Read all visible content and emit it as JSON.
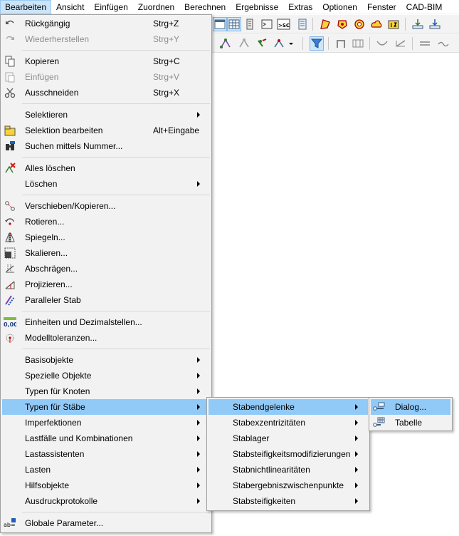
{
  "menubar": {
    "items": [
      "Bearbeiten",
      "Ansicht",
      "Einfügen",
      "Zuordnen",
      "Berechnen",
      "Ergebnisse",
      "Extras",
      "Optionen",
      "Fenster",
      "CAD-BIM"
    ],
    "active_index": 0
  },
  "main_menu": {
    "items": [
      {
        "label": "Rückgängig",
        "shortcut": "Strg+Z",
        "icon": "undo-icon"
      },
      {
        "label": "Wiederherstellen",
        "shortcut": "Strg+Y",
        "icon": "redo-icon",
        "disabled": true
      },
      {
        "label": "Kopieren",
        "shortcut": "Strg+C",
        "icon": "copy-icon"
      },
      {
        "label": "Einfügen",
        "shortcut": "Strg+V",
        "icon": "paste-icon",
        "disabled": true
      },
      {
        "label": "Ausschneiden",
        "shortcut": "Strg+X",
        "icon": "cut-icon"
      },
      {
        "label": "Selektieren",
        "submenu": true
      },
      {
        "label": "Selektion bearbeiten",
        "shortcut": "Alt+Eingabe",
        "icon": "edit-selection-icon"
      },
      {
        "label": "Suchen mittels Nummer...",
        "icon": "binoculars-icon"
      },
      {
        "label": "Alles löschen",
        "icon": "delete-all-icon"
      },
      {
        "label": "Löschen",
        "submenu": true
      },
      {
        "label": "Verschieben/Kopieren...",
        "icon": "move-copy-icon"
      },
      {
        "label": "Rotieren...",
        "icon": "rotate-icon"
      },
      {
        "label": "Spiegeln...",
        "icon": "mirror-icon"
      },
      {
        "label": "Skalieren...",
        "icon": "scale-icon"
      },
      {
        "label": "Abschrägen...",
        "icon": "shear-icon"
      },
      {
        "label": "Projizieren...",
        "icon": "project-icon"
      },
      {
        "label": "Paralleler Stab",
        "icon": "parallel-member-icon"
      },
      {
        "label": "Einheiten und Dezimalstellen...",
        "icon": "units-icon"
      },
      {
        "label": "Modelltoleranzen...",
        "icon": "tolerance-icon"
      },
      {
        "label": "Basisobjekte",
        "submenu": true
      },
      {
        "label": "Spezielle Objekte",
        "submenu": true
      },
      {
        "label": "Typen für Knoten",
        "submenu": true
      },
      {
        "label": "Typen für Stäbe",
        "submenu": true,
        "highlighted": true
      },
      {
        "label": "Imperfektionen",
        "submenu": true
      },
      {
        "label": "Lastfälle und Kombinationen",
        "submenu": true
      },
      {
        "label": "Lastassistenten",
        "submenu": true
      },
      {
        "label": "Lasten",
        "submenu": true
      },
      {
        "label": "Hilfsobjekte",
        "submenu": true
      },
      {
        "label": "Ausdruckprotokolle",
        "submenu": true
      },
      {
        "label": "Globale Parameter...",
        "icon": "global-parameters-icon"
      }
    ],
    "units_icon_text": "0,00",
    "global_icon_text": "ab="
  },
  "submenu_staebe": {
    "items": [
      {
        "label": "Stabendgelenke",
        "highlighted": true
      },
      {
        "label": "Stabexzentrizitäten"
      },
      {
        "label": "Stablager"
      },
      {
        "label": "Stabsteifigkeitsmodifizierungen"
      },
      {
        "label": "Stabnichtlinearitäten"
      },
      {
        "label": "Stabergebniszwischenpunkte"
      },
      {
        "label": "Stabsteifigkeiten"
      }
    ]
  },
  "submenu_gelenke": {
    "items": [
      {
        "label": "Dialog...",
        "highlighted": true,
        "icon": "hinge-dialog-icon"
      },
      {
        "label": "Tabelle",
        "icon": "hinge-table-icon"
      }
    ]
  },
  "toolbar": {
    "sc_label": ">SC"
  },
  "colors": {
    "highlight": "#91c9f7",
    "menu_bg": "#f2f2f2",
    "disabled_text": "#8d8d8d"
  }
}
